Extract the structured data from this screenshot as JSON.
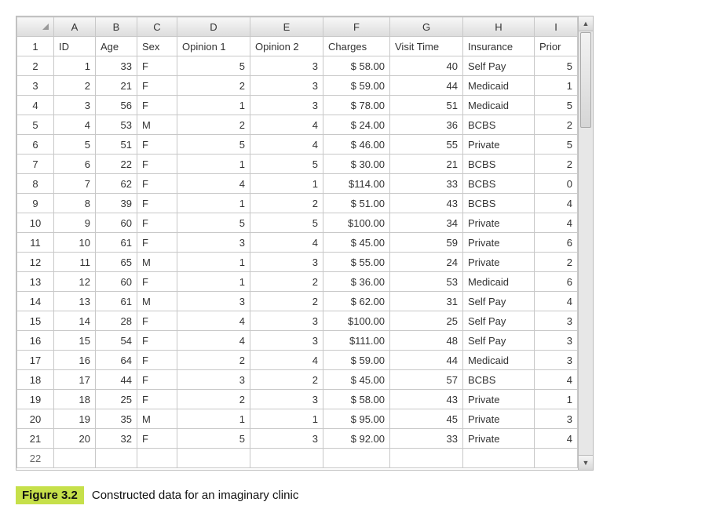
{
  "columns": [
    "A",
    "B",
    "C",
    "D",
    "E",
    "F",
    "G",
    "H",
    "I"
  ],
  "headers": {
    "A": "ID",
    "B": "Age",
    "C": "Sex",
    "D": "Opinion 1",
    "E": "Opinion 2",
    "F": "Charges",
    "G": "Visit Time",
    "H": "Insurance",
    "I": "Prior"
  },
  "rows": [
    {
      "n": "2",
      "A": "1",
      "B": "33",
      "C": "F",
      "D": "5",
      "E": "3",
      "F": "$ 58.00",
      "G": "40",
      "H": "Self Pay",
      "I": "5"
    },
    {
      "n": "3",
      "A": "2",
      "B": "21",
      "C": "F",
      "D": "2",
      "E": "3",
      "F": "$ 59.00",
      "G": "44",
      "H": "Medicaid",
      "I": "1"
    },
    {
      "n": "4",
      "A": "3",
      "B": "56",
      "C": "F",
      "D": "1",
      "E": "3",
      "F": "$ 78.00",
      "G": "51",
      "H": "Medicaid",
      "I": "5"
    },
    {
      "n": "5",
      "A": "4",
      "B": "53",
      "C": "M",
      "D": "2",
      "E": "4",
      "F": "$ 24.00",
      "G": "36",
      "H": "BCBS",
      "I": "2"
    },
    {
      "n": "6",
      "A": "5",
      "B": "51",
      "C": "F",
      "D": "5",
      "E": "4",
      "F": "$ 46.00",
      "G": "55",
      "H": "Private",
      "I": "5"
    },
    {
      "n": "7",
      "A": "6",
      "B": "22",
      "C": "F",
      "D": "1",
      "E": "5",
      "F": "$ 30.00",
      "G": "21",
      "H": "BCBS",
      "I": "2"
    },
    {
      "n": "8",
      "A": "7",
      "B": "62",
      "C": "F",
      "D": "4",
      "E": "1",
      "F": "$114.00",
      "G": "33",
      "H": "BCBS",
      "I": "0"
    },
    {
      "n": "9",
      "A": "8",
      "B": "39",
      "C": "F",
      "D": "1",
      "E": "2",
      "F": "$ 51.00",
      "G": "43",
      "H": "BCBS",
      "I": "4"
    },
    {
      "n": "10",
      "A": "9",
      "B": "60",
      "C": "F",
      "D": "5",
      "E": "5",
      "F": "$100.00",
      "G": "34",
      "H": "Private",
      "I": "4"
    },
    {
      "n": "11",
      "A": "10",
      "B": "61",
      "C": "F",
      "D": "3",
      "E": "4",
      "F": "$ 45.00",
      "G": "59",
      "H": "Private",
      "I": "6"
    },
    {
      "n": "12",
      "A": "11",
      "B": "65",
      "C": "M",
      "D": "1",
      "E": "3",
      "F": "$ 55.00",
      "G": "24",
      "H": "Private",
      "I": "2"
    },
    {
      "n": "13",
      "A": "12",
      "B": "60",
      "C": "F",
      "D": "1",
      "E": "2",
      "F": "$ 36.00",
      "G": "53",
      "H": "Medicaid",
      "I": "6"
    },
    {
      "n": "14",
      "A": "13",
      "B": "61",
      "C": "M",
      "D": "3",
      "E": "2",
      "F": "$ 62.00",
      "G": "31",
      "H": "Self Pay",
      "I": "4"
    },
    {
      "n": "15",
      "A": "14",
      "B": "28",
      "C": "F",
      "D": "4",
      "E": "3",
      "F": "$100.00",
      "G": "25",
      "H": "Self Pay",
      "I": "3"
    },
    {
      "n": "16",
      "A": "15",
      "B": "54",
      "C": "F",
      "D": "4",
      "E": "3",
      "F": "$111.00",
      "G": "48",
      "H": "Self Pay",
      "I": "3"
    },
    {
      "n": "17",
      "A": "16",
      "B": "64",
      "C": "F",
      "D": "2",
      "E": "4",
      "F": "$ 59.00",
      "G": "44",
      "H": "Medicaid",
      "I": "3"
    },
    {
      "n": "18",
      "A": "17",
      "B": "44",
      "C": "F",
      "D": "3",
      "E": "2",
      "F": "$ 45.00",
      "G": "57",
      "H": "BCBS",
      "I": "4"
    },
    {
      "n": "19",
      "A": "18",
      "B": "25",
      "C": "F",
      "D": "2",
      "E": "3",
      "F": "$ 58.00",
      "G": "43",
      "H": "Private",
      "I": "1"
    },
    {
      "n": "20",
      "A": "19",
      "B": "35",
      "C": "M",
      "D": "1",
      "E": "1",
      "F": "$ 95.00",
      "G": "45",
      "H": "Private",
      "I": "3"
    },
    {
      "n": "21",
      "A": "20",
      "B": "32",
      "C": "F",
      "D": "5",
      "E": "3",
      "F": "$ 92.00",
      "G": "33",
      "H": "Private",
      "I": "4"
    }
  ],
  "truncated_row": "22",
  "caption": {
    "label": "Figure 3.2",
    "text": "Constructed data for an imaginary clinic"
  }
}
